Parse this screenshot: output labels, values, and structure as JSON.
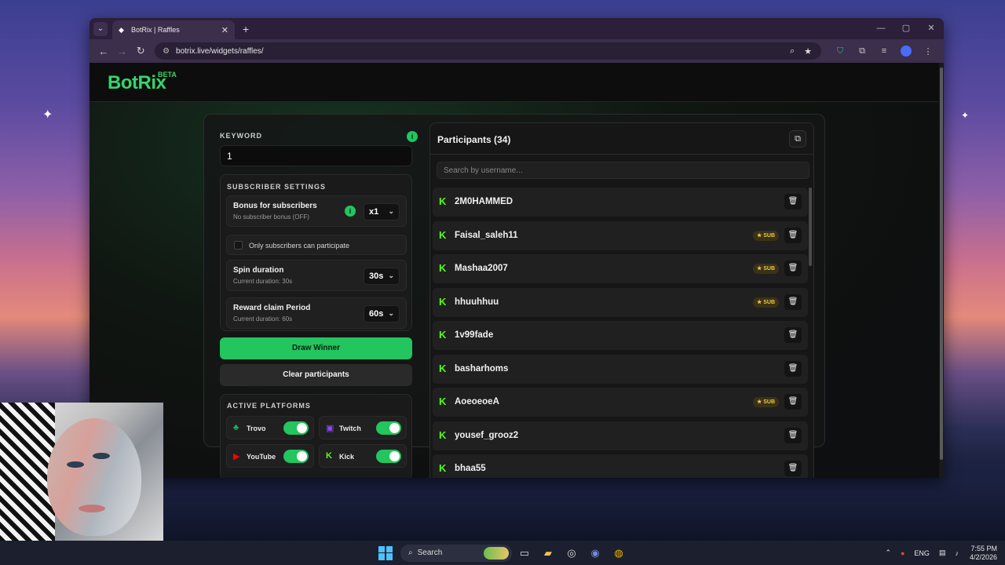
{
  "browser": {
    "tab_title": "BotRix | Raffles",
    "tab_close": "✕",
    "new_tab": "+",
    "url": "botrix.live/widgets/raffles/"
  },
  "header": {
    "logo": "BotRix",
    "beta": "BETA"
  },
  "keyword": {
    "label": "KEYWORD",
    "value": "1",
    "info": "i"
  },
  "subscriber_settings": {
    "title": "SUBSCRIBER SETTINGS",
    "bonus_title": "Bonus for subscribers",
    "bonus_sub": "No subscriber bonus (OFF)",
    "bonus_value": "x1",
    "only_subs_label": "Only subscribers can participate",
    "spin_title": "Spin duration",
    "spin_sub": "Current duration: 30s",
    "spin_value": "30s",
    "reward_title": "Reward claim Period",
    "reward_sub": "Current duration: 60s",
    "reward_value": "60s"
  },
  "buttons": {
    "draw": "Draw Winner",
    "clear": "Clear participants"
  },
  "platforms": {
    "title": "ACTIVE PLATFORMS",
    "items": [
      {
        "name": "Trovo",
        "enabled": true,
        "color": "#1bb46a"
      },
      {
        "name": "Twitch",
        "enabled": true,
        "color": "#9146ff"
      },
      {
        "name": "YouTube",
        "enabled": true,
        "color": "#ff0000"
      },
      {
        "name": "Kick",
        "enabled": true,
        "color": "#53fc18"
      }
    ]
  },
  "participants": {
    "title": "Participants (34)",
    "search_placeholder": "Search by username...",
    "sub_badge": "SUB",
    "rows": [
      {
        "name": "2M0HAMMED",
        "sub": false
      },
      {
        "name": "Faisal_saleh11",
        "sub": true
      },
      {
        "name": "Mashaa2007",
        "sub": true
      },
      {
        "name": "hhuuhhuu",
        "sub": true
      },
      {
        "name": "1v99fade",
        "sub": false
      },
      {
        "name": "basharhoms",
        "sub": false
      },
      {
        "name": "AoeoeoeA",
        "sub": true
      },
      {
        "name": "yousef_grooz2",
        "sub": false
      },
      {
        "name": "bhaa55",
        "sub": false
      }
    ]
  },
  "taskbar": {
    "search": "Search",
    "lang": "ENG",
    "time": "7:55 PM",
    "date": "4/2/2026"
  },
  "colors": {
    "accent": "#22c55e",
    "kick": "#53fc18",
    "sub_badge": "#f4c542"
  }
}
